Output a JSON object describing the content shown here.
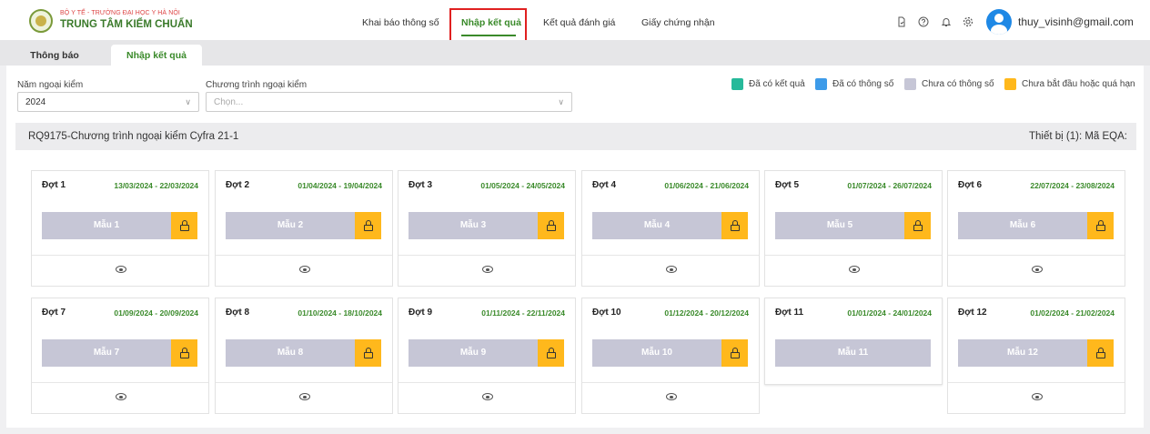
{
  "brand": {
    "line1": "BỘ Y TẾ - TRƯỜNG ĐẠI HỌC Y HÀ NỘI",
    "line2": "TRUNG TÂM KIỂM CHUẨN"
  },
  "nav": {
    "items": [
      {
        "label": "Khai báo thông số"
      },
      {
        "label": "Nhập kết quả"
      },
      {
        "label": "Kết quả đánh giá"
      },
      {
        "label": "Giấy chứng nhận"
      }
    ],
    "active": "Nhập kết quả"
  },
  "header_icons": [
    "document-icon",
    "help-icon",
    "bell-icon",
    "gear-icon"
  ],
  "user": {
    "email": "thuy_visinh@gmail.com"
  },
  "tabs": [
    {
      "label": "Thông báo"
    },
    {
      "label": "Nhập kết quả"
    }
  ],
  "filters": {
    "year": {
      "label": "Năm ngoại kiểm",
      "value": "2024"
    },
    "program": {
      "label": "Chương trình ngoại kiểm",
      "placeholder": "Chọn..."
    }
  },
  "legend": [
    {
      "label": "Đã có kết quả",
      "color": "#26b99a"
    },
    {
      "label": "Đã có thông số",
      "color": "#3d9be9"
    },
    {
      "label": "Chưa có thông số",
      "color": "#c6c6d6"
    },
    {
      "label": "Chưa bắt đầu hoặc quá hạn",
      "color": "#ffb81c"
    }
  ],
  "section": {
    "title": "RQ9175-Chương trình ngoại kiểm Cyfra 21-1",
    "right": "Thiết bị (1):  Mã EQA:"
  },
  "rounds": [
    {
      "name": "Đợt 1",
      "dates": "13/03/2024 - 22/03/2024",
      "sample": "Mẫu 1",
      "locked": true,
      "view": true
    },
    {
      "name": "Đợt 2",
      "dates": "01/04/2024 - 19/04/2024",
      "sample": "Mẫu 2",
      "locked": true,
      "view": true
    },
    {
      "name": "Đợt 3",
      "dates": "01/05/2024 - 24/05/2024",
      "sample": "Mẫu 3",
      "locked": true,
      "view": true
    },
    {
      "name": "Đợt 4",
      "dates": "01/06/2024 - 21/06/2024",
      "sample": "Mẫu 4",
      "locked": true,
      "view": true
    },
    {
      "name": "Đợt 5",
      "dates": "01/07/2024 - 26/07/2024",
      "sample": "Mẫu 5",
      "locked": true,
      "view": true
    },
    {
      "name": "Đợt 6",
      "dates": "22/07/2024 - 23/08/2024",
      "sample": "Mẫu 6",
      "locked": true,
      "view": true
    },
    {
      "name": "Đợt 7",
      "dates": "01/09/2024 - 20/09/2024",
      "sample": "Mẫu 7",
      "locked": true,
      "view": true
    },
    {
      "name": "Đợt 8",
      "dates": "01/10/2024 - 18/10/2024",
      "sample": "Mẫu 8",
      "locked": true,
      "view": true
    },
    {
      "name": "Đợt 9",
      "dates": "01/11/2024 - 22/11/2024",
      "sample": "Mẫu 9",
      "locked": true,
      "view": true
    },
    {
      "name": "Đợt 10",
      "dates": "01/12/2024 - 20/12/2024",
      "sample": "Mẫu 10",
      "locked": true,
      "view": true
    },
    {
      "name": "Đợt 11",
      "dates": "01/01/2024 - 24/01/2024",
      "sample": "Mẫu 11",
      "locked": false,
      "view": false
    },
    {
      "name": "Đợt 12",
      "dates": "01/02/2024 - 21/02/2024",
      "sample": "Mẫu 12",
      "locked": true,
      "view": true
    }
  ]
}
